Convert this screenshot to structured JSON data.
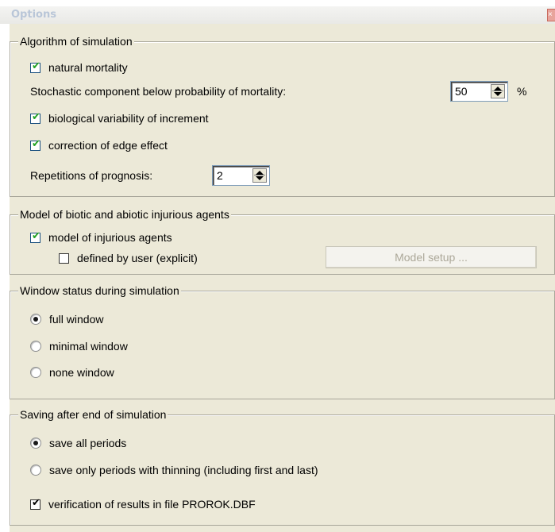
{
  "window": {
    "title": "Options",
    "close_glyph": "×"
  },
  "algorithm": {
    "legend": "Algorithm of simulation",
    "natural_mortality": {
      "label": "natural mortality",
      "checked": true
    },
    "stochastic": {
      "label": "Stochastic component below probability of mortality:",
      "value": "50",
      "unit": "%"
    },
    "bio_variability": {
      "label": "biological variability of increment",
      "checked": true
    },
    "edge_effect": {
      "label": "correction of edge effect",
      "checked": true
    },
    "repetitions": {
      "label": "Repetitions of prognosis:",
      "value": "2"
    }
  },
  "injurious": {
    "legend": "Model of biotic and abiotic injurious agents",
    "model": {
      "label": "model of injurious agents",
      "checked": true
    },
    "user_defined": {
      "label": "defined by user (explicit)",
      "checked": false
    },
    "setup_button": "Model setup ..."
  },
  "window_status": {
    "legend": "Window status during simulation",
    "options": [
      {
        "label": "full window",
        "selected": true
      },
      {
        "label": "minimal window",
        "selected": false
      },
      {
        "label": "none window",
        "selected": false
      }
    ]
  },
  "saving": {
    "legend": "Saving after end of simulation",
    "options": [
      {
        "label": "save all periods",
        "selected": true
      },
      {
        "label": "save only periods with thinning (including first and last)",
        "selected": false
      }
    ],
    "verification": {
      "label": "verification of results in file PROROK.DBF",
      "checked": true
    }
  },
  "tick_glyph": "✔",
  "colors": {
    "window_bg": "#ece9d8",
    "checkmark": "#21a121",
    "disabled_text": "#aca899"
  }
}
